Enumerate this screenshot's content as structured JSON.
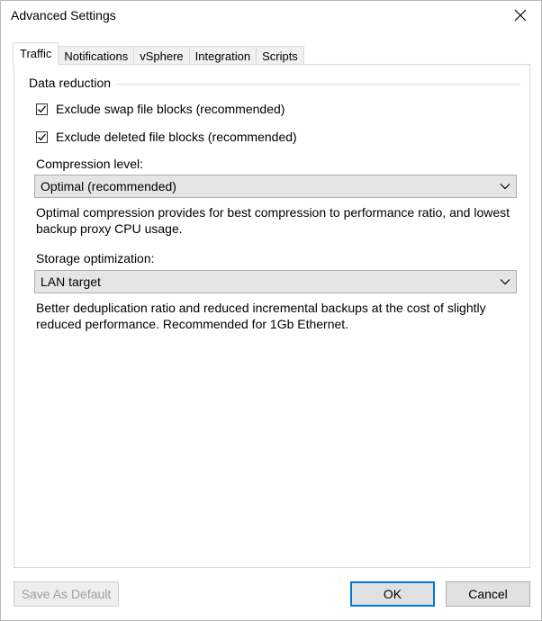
{
  "window": {
    "title": "Advanced Settings"
  },
  "tabs": [
    {
      "label": "Traffic",
      "active": true
    },
    {
      "label": "Notifications",
      "active": false
    },
    {
      "label": "vSphere",
      "active": false
    },
    {
      "label": "Integration",
      "active": false
    },
    {
      "label": "Scripts",
      "active": false
    }
  ],
  "data_reduction": {
    "title": "Data reduction",
    "exclude_swap": {
      "label": "Exclude swap file blocks (recommended)",
      "checked": true
    },
    "exclude_deleted": {
      "label": "Exclude deleted file blocks (recommended)",
      "checked": true
    }
  },
  "compression": {
    "label": "Compression level:",
    "value": "Optimal (recommended)",
    "description": "Optimal compression provides for best compression to performance ratio, and lowest backup proxy CPU usage."
  },
  "storage": {
    "label": "Storage optimization:",
    "value": "LAN target",
    "description": "Better deduplication ratio and reduced incremental backups at the cost of slightly reduced performance. Recommended for 1Gb Ethernet."
  },
  "buttons": {
    "save_default": "Save As Default",
    "ok": "OK",
    "cancel": "Cancel"
  },
  "icons": {
    "close": "close-icon",
    "check": "check-icon",
    "chevron": "chevron-down-icon"
  },
  "colors": {
    "accent": "#0078d7",
    "border": "#adadad",
    "select_bg": "#e5e5e5"
  }
}
